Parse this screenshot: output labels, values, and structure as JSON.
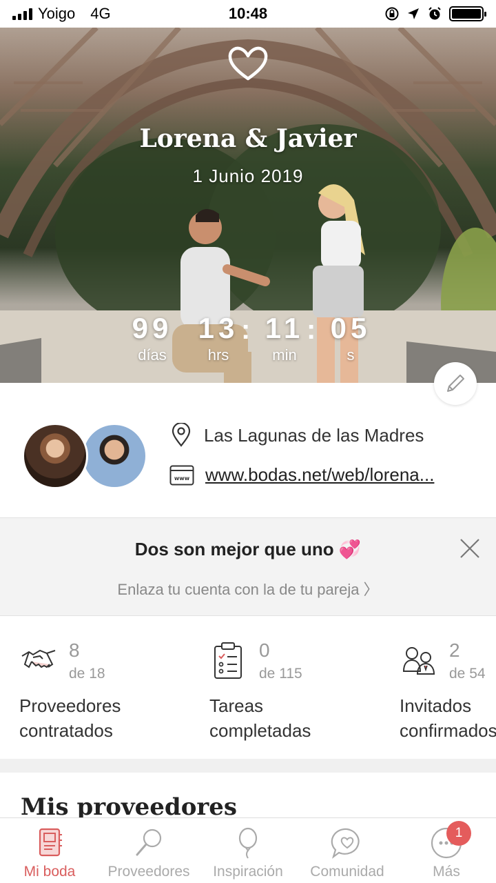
{
  "status_bar": {
    "carrier": "Yoigo",
    "network": "4G",
    "time": "10:48"
  },
  "hero": {
    "couple_names": "Lorena & Javier",
    "date": "1 Junio 2019",
    "countdown": {
      "days": "99",
      "days_label": "días",
      "hours": "13",
      "hours_label": "hrs",
      "minutes": "11",
      "minutes_label": "min",
      "seconds": "05",
      "seconds_label": "s"
    }
  },
  "profile": {
    "location": "Las Lagunas de las Madres",
    "website": "www.bodas.net/web/lorena..."
  },
  "banner": {
    "title": "Dos son mejor que uno 💞",
    "subtitle": "Enlaza tu cuenta con la de tu pareja  〉"
  },
  "stats": [
    {
      "icon": "handshake-icon",
      "value": "8",
      "of": "de 18",
      "label_line1": "Proveedores",
      "label_line2": "contratados"
    },
    {
      "icon": "checklist-icon",
      "value": "0",
      "of": "de 115",
      "label_line1": "Tareas",
      "label_line2": "completadas"
    },
    {
      "icon": "guests-icon",
      "value": "2",
      "of": "de 54",
      "label_line1": "Invitados",
      "label_line2": "confirmados"
    }
  ],
  "section_title": "Mis proveedores",
  "tabbar": {
    "items": [
      {
        "label": "Mi boda",
        "icon": "notebook-icon"
      },
      {
        "label": "Proveedores",
        "icon": "search-icon"
      },
      {
        "label": "Inspiración",
        "icon": "balloon-icon"
      },
      {
        "label": "Comunidad",
        "icon": "chat-heart-icon"
      },
      {
        "label": "Más",
        "icon": "more-icon"
      }
    ],
    "badge": "1"
  },
  "colors": {
    "accent": "#d95d5d",
    "badge": "#e45c5c",
    "muted": "#999999"
  }
}
